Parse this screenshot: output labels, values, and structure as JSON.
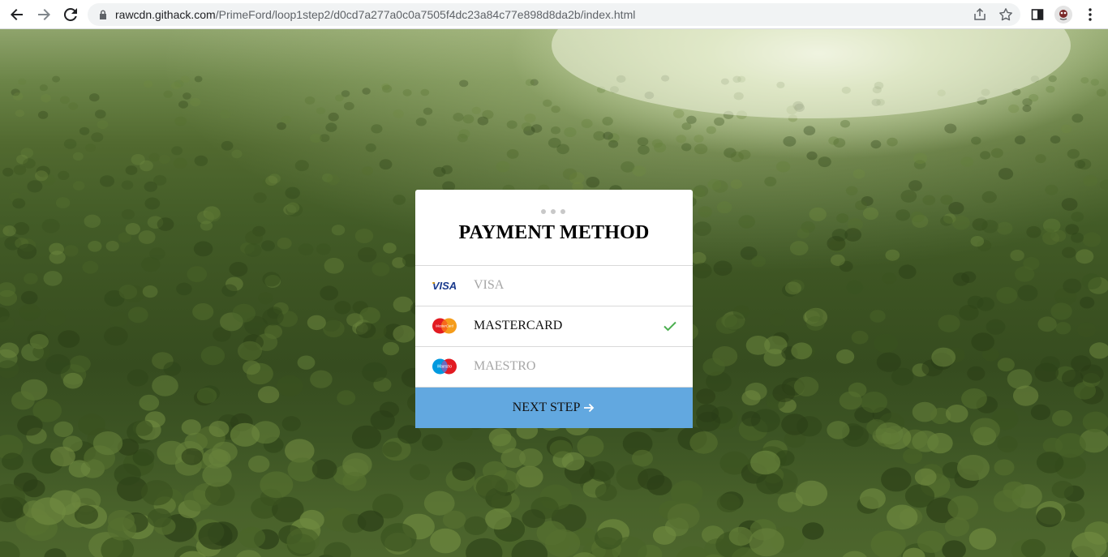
{
  "browser": {
    "url_host": "rawcdn.githack.com",
    "url_path": "/PrimeFord/loop1step2/d0cd7a277a0c0a7505f4dc23a84c77e898d8da2b/index.html",
    "icons": [
      "back-arrow-icon",
      "forward-arrow-icon",
      "reload-icon",
      "lock-icon",
      "share-icon",
      "star-icon",
      "side-panel-icon",
      "profile-avatar",
      "kebab-menu-icon"
    ]
  },
  "card": {
    "title": "PAYMENT METHOD",
    "options": [
      {
        "label": "VISA",
        "logo": "visa-logo",
        "selected": false
      },
      {
        "label": "MASTERCARD",
        "logo": "mastercard-logo",
        "selected": true
      },
      {
        "label": "MAESTRO",
        "logo": "maestro-logo",
        "selected": false
      }
    ],
    "next_label": "NEXT STEP",
    "logos": {
      "visa": "VISA",
      "mastercard": "MasterCard",
      "maestro": "Maestro"
    }
  },
  "colors": {
    "button": "#62a8e0",
    "check": "#4caf50",
    "muted_label": "#a6a6a6"
  }
}
